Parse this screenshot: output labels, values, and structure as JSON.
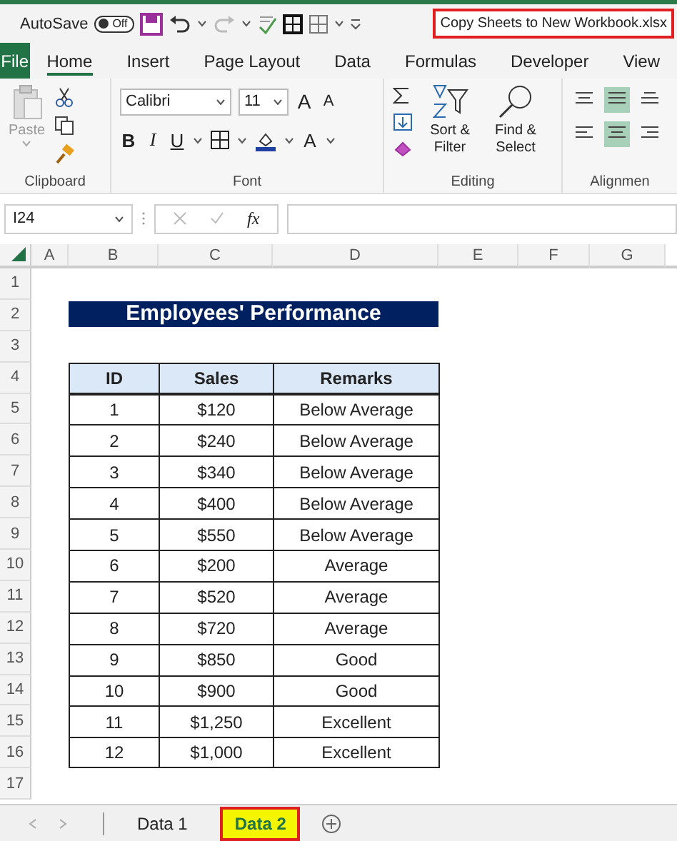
{
  "quick_access": {
    "autosave_label": "AutoSave",
    "autosave_toggle": {
      "label": "Off",
      "on": false
    }
  },
  "window": {
    "title": "Copy Sheets to New Workbook.xlsx"
  },
  "tabs": [
    {
      "label": "File",
      "kind": "file",
      "selected": false
    },
    {
      "label": "Home",
      "kind": "tab",
      "selected": true
    },
    {
      "label": "Insert",
      "kind": "tab",
      "selected": false
    },
    {
      "label": "Page Layout",
      "kind": "tab",
      "selected": false
    },
    {
      "label": "Data",
      "kind": "tab",
      "selected": false
    },
    {
      "label": "Formulas",
      "kind": "tab",
      "selected": false
    },
    {
      "label": "Developer",
      "kind": "tab",
      "selected": false
    },
    {
      "label": "View",
      "kind": "tab",
      "selected": false
    }
  ],
  "ribbon": {
    "clipboard": {
      "paste": "Paste",
      "label": "Clipboard"
    },
    "font": {
      "font_name": "Calibri",
      "font_size": "11",
      "grow": "A",
      "shrink": "A",
      "bold": "B",
      "italic": "I",
      "underline": "U",
      "font_color": "A",
      "label": "Font"
    },
    "editing": {
      "sort": "Sort & Filter",
      "find": "Find & Select",
      "label": "Editing"
    },
    "alignment": {
      "label": "Alignmen"
    }
  },
  "formula_bar": {
    "name_box": "I24",
    "function": "fx"
  },
  "columns": [
    "A",
    "B",
    "C",
    "D",
    "E",
    "F",
    "G"
  ],
  "row_numbers": [
    "1",
    "2",
    "3",
    "4",
    "5",
    "6",
    "7",
    "8",
    "9",
    "10",
    "11",
    "12",
    "13",
    "14",
    "15",
    "16",
    "17"
  ],
  "sheet": {
    "title": "Employees' Performance",
    "table": {
      "columns": [
        "ID",
        "Sales",
        "Remarks"
      ],
      "rows": [
        [
          "1",
          "$120",
          "Below Average"
        ],
        [
          "2",
          "$240",
          "Below Average"
        ],
        [
          "3",
          "$340",
          "Below Average"
        ],
        [
          "4",
          "$400",
          "Below Average"
        ],
        [
          "5",
          "$550",
          "Below Average"
        ],
        [
          "6",
          "$200",
          "Average"
        ],
        [
          "7",
          "$520",
          "Average"
        ],
        [
          "8",
          "$720",
          "Average"
        ],
        [
          "9",
          "$850",
          "Good"
        ],
        [
          "10",
          "$900",
          "Good"
        ],
        [
          "11",
          "$1,250",
          "Excellent"
        ],
        [
          "12",
          "$1,000",
          "Excellent"
        ]
      ]
    }
  },
  "sheet_tabs": [
    {
      "label": "Data 1",
      "selected": false
    },
    {
      "label": "Data 2",
      "selected": true
    }
  ]
}
